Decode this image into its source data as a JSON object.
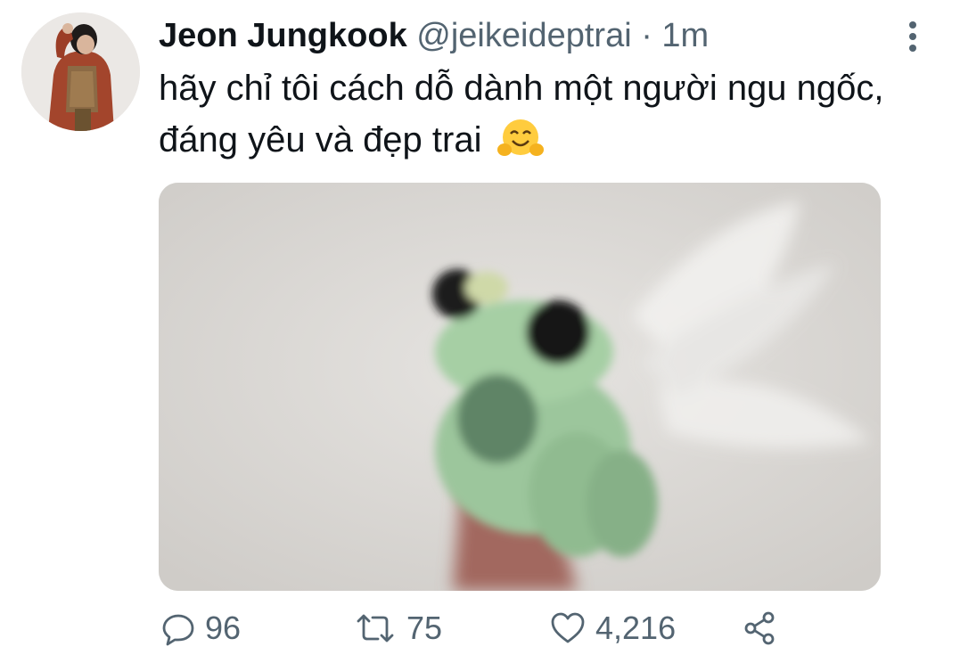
{
  "tweet": {
    "author_name": "Jeon Jungkook",
    "handle": "@jeikeideptrai",
    "separator": "·",
    "time": "1m",
    "text": "hãy chỉ tôi cách dỗ dành một người ngu ngốc, đáng yêu và đẹp trai",
    "emoji": "hugging-face-emoji"
  },
  "actions": {
    "replies": "96",
    "retweets": "75",
    "likes": "4,216"
  },
  "colors": {
    "text": "#0f1419",
    "secondary": "#536471"
  }
}
